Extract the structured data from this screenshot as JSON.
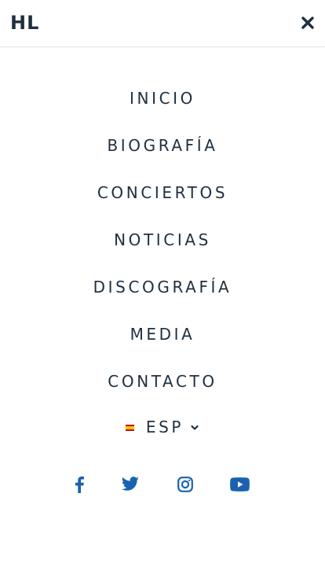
{
  "header": {
    "logo_text": "HL",
    "close_icon": "close-icon"
  },
  "menu": {
    "items": [
      {
        "label": "INICIO"
      },
      {
        "label": "BIOGRAFÍA"
      },
      {
        "label": "CONCIERTOS"
      },
      {
        "label": "NOTICIAS"
      },
      {
        "label": "DISCOGRAFÍA"
      },
      {
        "label": "MEDIA"
      },
      {
        "label": "CONTACTO"
      }
    ]
  },
  "language": {
    "selected": "ESP",
    "flag_icon": "spain-flag-icon",
    "chevron_icon": "chevron-down-icon"
  },
  "social": {
    "icons": [
      "facebook-icon",
      "twitter-icon",
      "instagram-icon",
      "youtube-icon"
    ]
  },
  "colors": {
    "text": "#1f2f3f",
    "social_accent": "#1a62b0",
    "background": "#ffffff"
  }
}
